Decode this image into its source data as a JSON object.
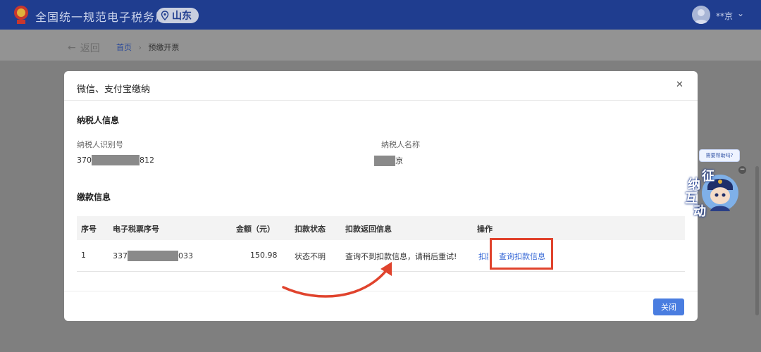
{
  "header": {
    "site_title": "全国统一规范电子税务局",
    "province": "山东",
    "user_name": "**京"
  },
  "subnav": {
    "back_label": "返回",
    "breadcrumb_home": "首页",
    "breadcrumb_current": "预缴开票"
  },
  "modal": {
    "title": "微信、支付宝缴纳",
    "close_icon": "close-icon",
    "taxpayer_section": "纳税人信息",
    "taxpayer_id_label": "纳税人识别号",
    "taxpayer_id_prefix": "370",
    "taxpayer_id_suffix": "812",
    "taxpayer_name_label": "纳税人名称",
    "taxpayer_name_suffix": "京",
    "payment_section": "缴款信息",
    "table": {
      "headers": [
        "序号",
        "电子税票序号",
        "金额（元）",
        "扣款状态",
        "扣款返回信息",
        "操作"
      ],
      "rows": [
        {
          "index": "1",
          "ticket_prefix": "337",
          "ticket_suffix": "033",
          "amount": "150.98",
          "status": "状态不明",
          "message": "查询不到扣款信息，请稍后重试!",
          "op_deduct": "扣款",
          "op_query": "查询扣款信息"
        }
      ]
    },
    "close_button": "关闭"
  },
  "assistant": {
    "bubble": "需要帮助吗?",
    "chars": [
      "征",
      "纳",
      "互",
      "动"
    ]
  },
  "colors": {
    "header_bg": "#1f3d8f",
    "link": "#3768d6",
    "primary_button": "#4a7de0",
    "annotation": "#e0432d"
  }
}
